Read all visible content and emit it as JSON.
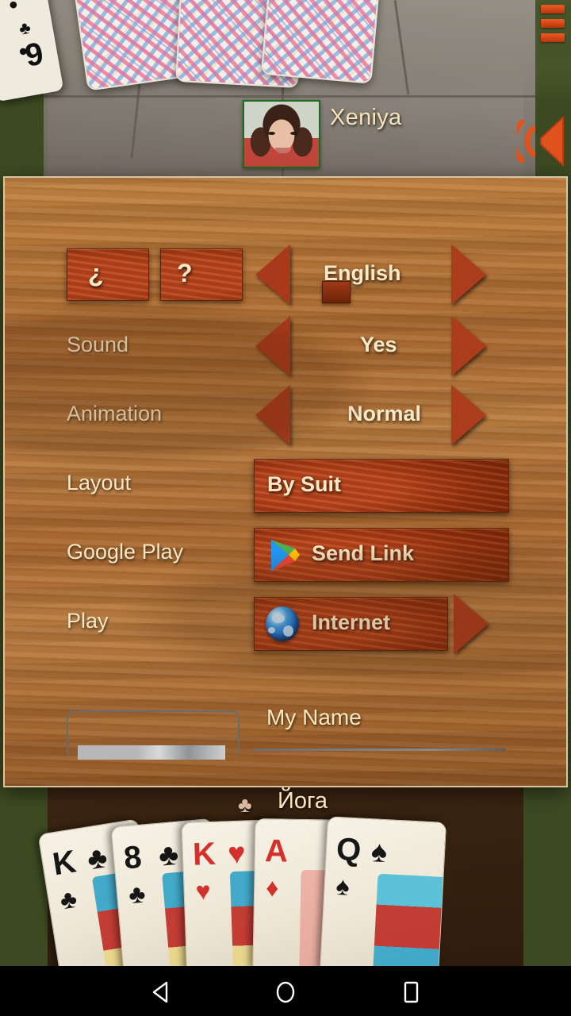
{
  "app": {
    "top_player": {
      "name": "Xeniya"
    },
    "bottom_player": {
      "name": "Йога",
      "suit_icon": "club-suit-icon",
      "suit_glyph": "♣"
    },
    "icons": {
      "menu": "hamburger-menu-icon",
      "sound": "speaker-on-icon"
    }
  },
  "settings_dialog": {
    "help_button": "¿",
    "question_button": "?",
    "rows": [
      {
        "key": "language",
        "label": "",
        "value": "English",
        "left_arrow": "◀",
        "right_arrow": "▶"
      },
      {
        "key": "sound",
        "label": "Sound",
        "value": "Yes",
        "left_arrow": "◀",
        "right_arrow": "▶"
      },
      {
        "key": "animation",
        "label": "Animation",
        "value": "Normal",
        "left_arrow": "◀",
        "right_arrow": "▶"
      },
      {
        "key": "layout",
        "label": "Layout",
        "value": "By Suit"
      },
      {
        "key": "google_play",
        "label": "Google Play",
        "value": "Send Link",
        "icon": "google-play-icon"
      },
      {
        "key": "play",
        "label": "Play",
        "value": "Internet",
        "icon": "globe-icon",
        "right_arrow": "▶"
      }
    ],
    "name_field": {
      "label": "My Name",
      "value": "",
      "placeholder": ""
    }
  },
  "table_cards": {
    "left_card": {
      "rank": "9",
      "suit": "♣"
    },
    "hand": [
      {
        "rank": "K",
        "suit": "♣",
        "color": "black"
      },
      {
        "rank": "8",
        "suit": "♣",
        "color": "black"
      },
      {
        "rank": "K",
        "suit": "♥",
        "color": "red"
      },
      {
        "rank": "A",
        "suit": "♦",
        "color": "red"
      },
      {
        "rank": "Q",
        "suit": "♠",
        "color": "black"
      }
    ]
  },
  "navbar": {
    "back": "back-button",
    "home": "home-button",
    "recents": "recents-button"
  },
  "colors": {
    "panel_wood": "#a96a31",
    "button_wood": "#a8391b",
    "text_cream": "#fbe9c6",
    "accent_orange": "#f05a23"
  }
}
